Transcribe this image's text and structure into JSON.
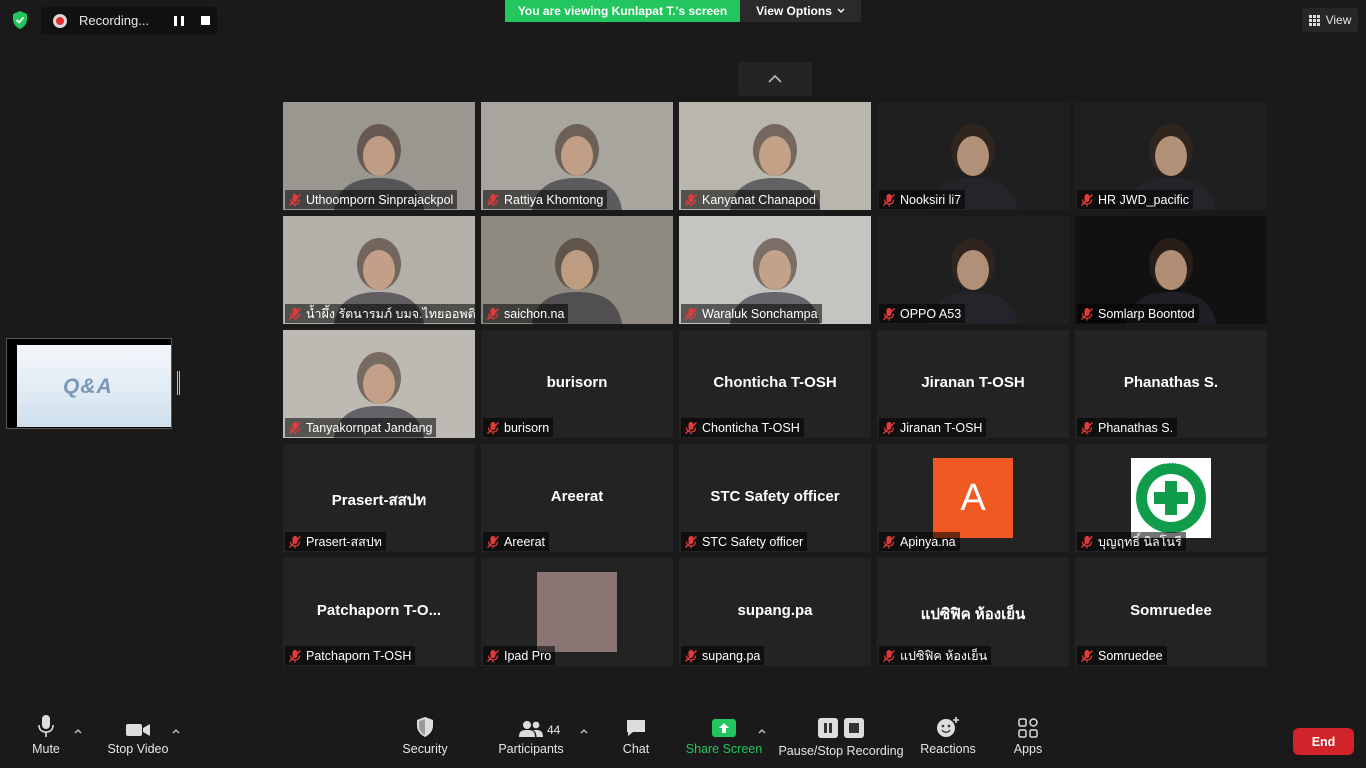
{
  "recording": {
    "label": "Recording..."
  },
  "banner": {
    "viewing": "You are viewing Kunlapat T.'s screen",
    "view_options": "View Options"
  },
  "view_button": {
    "label": "View"
  },
  "shared_screen": {
    "thumbnail_text": "Q&A"
  },
  "tiles": [
    {
      "name": "Uthoomporn Sinprajackpol",
      "video": true,
      "bg": "#9a9690"
    },
    {
      "name": "Rattiya Khomtong",
      "video": true,
      "bg": "#a7a59d"
    },
    {
      "name": "Kanyanat Chanapod",
      "video": true,
      "bg": "#b9b6ae"
    },
    {
      "name": "Nooksiri li7",
      "video": true,
      "bg": "#1f1f1f"
    },
    {
      "name": "HR JWD_pacific",
      "video": true,
      "bg": "#1f1f1f"
    },
    {
      "name": "น้ำผึ้ง รัตนารมภ์ บมจ.ไทยออพติ...",
      "video": true,
      "bg": "#b3b0a9"
    },
    {
      "name": "saichon.na",
      "video": true,
      "bg": "#8e8a80"
    },
    {
      "name": "Waraluk Sonchampa",
      "video": true,
      "bg": "#c5c4c0"
    },
    {
      "name": "OPPO A53",
      "video": true,
      "bg": "#1f1f1f"
    },
    {
      "name": "Somlarp Boontod",
      "video": true,
      "bg": "#111"
    },
    {
      "name": "Tanyakornpat Jandang",
      "video": true,
      "bg": "#bdbab4"
    },
    {
      "name": "burisorn",
      "big": "burisorn"
    },
    {
      "name": "Chonticha T-OSH",
      "big": "Chonticha T-OSH"
    },
    {
      "name": "Jiranan T-OSH",
      "big": "Jiranan T-OSH"
    },
    {
      "name": "Phanathas S.",
      "big": "Phanathas S."
    },
    {
      "name": "Prasert-สสปท",
      "big": "Prasert-สสปท"
    },
    {
      "name": "Areerat",
      "big": "Areerat"
    },
    {
      "name": "STC Safety officer",
      "big": "STC Safety officer"
    },
    {
      "name": "Apinya.na",
      "avatar_letter": "A",
      "avatar_color": "#f05a22"
    },
    {
      "name": "บุญฤทธิ์ นิลโนรี",
      "avatar_badge": "SAFETY FIRST"
    },
    {
      "name": "Patchaporn T-OSH",
      "big": "Patchaporn  T-O..."
    },
    {
      "name": "Ipad Pro",
      "avatar_color": "#8a7474"
    },
    {
      "name": "supang.pa",
      "big": "supang.pa"
    },
    {
      "name": "แปซิฟิค ห้องเย็น",
      "big": "แปซิฟิค ห้องเย็น"
    },
    {
      "name": "Somruedee",
      "big": "Somruedee"
    }
  ],
  "toolbar": {
    "mute": "Mute",
    "stop_video": "Stop Video",
    "security": "Security",
    "participants": "Participants",
    "participants_count": "44",
    "chat": "Chat",
    "share_screen": "Share Screen",
    "pause_stop_recording": "Pause/Stop Recording",
    "reactions": "Reactions",
    "apps": "Apps",
    "end": "End"
  },
  "colors": {
    "share_green": "#22c55e",
    "end_red": "#d1232a",
    "bg": "#1a1a1a"
  }
}
